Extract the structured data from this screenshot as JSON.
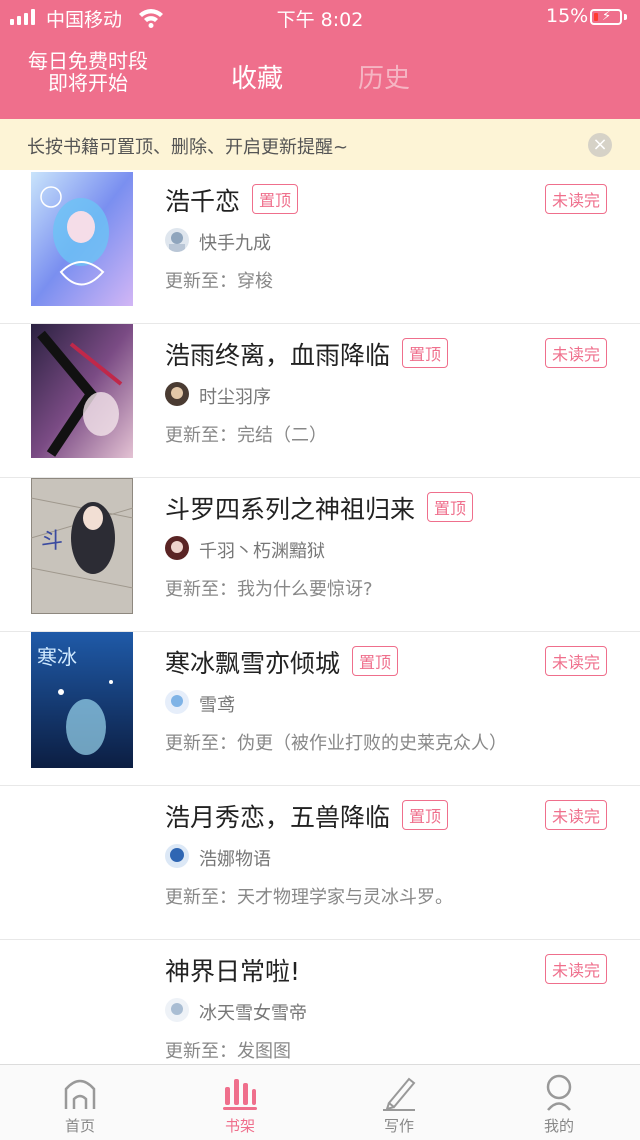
{
  "status_bar": {
    "carrier": "中国移动",
    "time": "下午 8:02",
    "battery": "15%"
  },
  "header": {
    "free_line1": "每日免费时段",
    "free_line2": "即将开始",
    "tab_favorites": "收藏",
    "tab_history": "历史"
  },
  "tip": {
    "text": "长按书籍可置顶、删除、开启更新提醒~",
    "close_icon": "×"
  },
  "labels": {
    "pin": "置顶",
    "unread": "未读完",
    "update_prefix": "更新至："
  },
  "books": [
    {
      "title": "浩千恋",
      "author": "快手九成",
      "update": "更新至：穿梭"
    },
    {
      "title": "浩雨终离，血雨降临",
      "author": "时尘羽序",
      "update": "更新至：完结（二）"
    },
    {
      "title": "斗罗四系列之神祖归来",
      "author": "千羽丶朽渊黯狱",
      "update": "更新至：我为什么要惊讶?"
    },
    {
      "title": "寒冰飘雪亦倾城",
      "author": "雪鸢",
      "update": "更新至：伪更（被作业打败的史莱克众人）"
    },
    {
      "title": "浩月秀恋，五兽降临",
      "author": "浩娜物语",
      "update": "更新至：天才物理学家与灵冰斗罗。"
    },
    {
      "title": "神界日常啦!",
      "author": "冰天雪女雪帝",
      "update": "更新至：发图图"
    }
  ],
  "nav": {
    "home": "首页",
    "shelf": "书架",
    "write": "写作",
    "me": "我的"
  },
  "colors": {
    "accent": "#ef6f8c",
    "tip_bg": "#fdf4d6"
  }
}
